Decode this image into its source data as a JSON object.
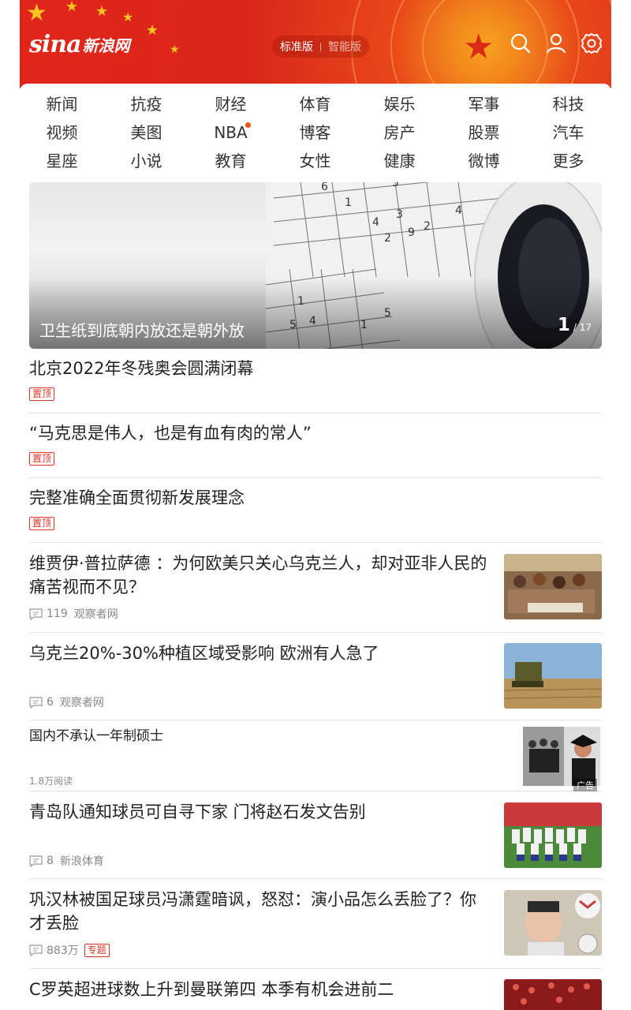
{
  "header": {
    "logo_text": "sina",
    "logo_cn": "新浪网",
    "version_active": "标准版",
    "version_inactive": "智能版",
    "icons": [
      "search-icon",
      "user-icon",
      "settings-icon"
    ]
  },
  "nav": {
    "rows": [
      [
        "新闻",
        "抗疫",
        "财经",
        "体育",
        "娱乐",
        "军事",
        "科技"
      ],
      [
        "视频",
        "美图",
        "NBA",
        "博客",
        "房产",
        "股票",
        "汽车"
      ],
      [
        "星座",
        "小说",
        "教育",
        "女性",
        "健康",
        "微博",
        "更多"
      ]
    ],
    "dot_item": "NBA"
  },
  "banner": {
    "caption": "卫生纸到底朝内放还是朝外放",
    "current": "1",
    "total": "/ 17"
  },
  "news": [
    {
      "title": "北京2022年冬残奥会圆满闭幕",
      "badge": "置顶"
    },
    {
      "title": "“马克思是伟人，也是有血有肉的常人”",
      "badge": "置顶"
    },
    {
      "title": "完整准确全面贯彻新发展理念",
      "badge": "置顶"
    },
    {
      "title": "维贾伊·普拉萨德 ：为何欧美只关心乌克兰人，却对亚非人民的痛苦视而不见？",
      "comments": "119",
      "source": "观察者网"
    },
    {
      "title": "乌克兰20%-30%种植区域受影响 欧洲有人急了",
      "comments": "6",
      "source": "观察者网"
    },
    {
      "title": "国内不承认一年制硕士",
      "reads": "1.8万阅读",
      "ad_label": "广告"
    },
    {
      "title": "青岛队通知球员可自寻下家 门将赵石发文告别",
      "comments": "8",
      "source": "新浪体育"
    },
    {
      "title": "巩汉林被国足球员冯潇霆暗讽，怒怼：演小品怎么丢脸了？你才丢脸",
      "comments": "883万",
      "badge": "专题"
    },
    {
      "title": "C罗英超进球数上升到曼联第四 本季有机会进前二"
    }
  ],
  "colors": {
    "header_red": "#e0261b",
    "header_orange": "#f28a1c",
    "badge_red": "#e0342a",
    "nav_dot": "#f2520f"
  }
}
